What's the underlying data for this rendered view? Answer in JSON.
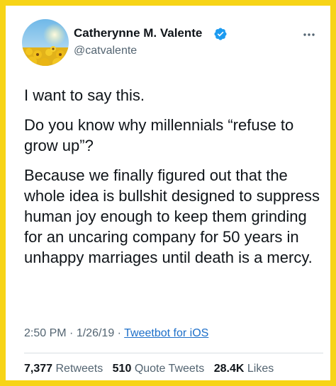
{
  "author": {
    "name": "Catherynne M. Valente",
    "handle": "@catvalente"
  },
  "icons": {
    "avatar": "sunflower-field-avatar",
    "verified": "verified-badge-icon",
    "more": "more-options-icon"
  },
  "colors": {
    "frame": "#f7d417",
    "verified": "#1d9bf0",
    "link": "#1d6fc9"
  },
  "tweet": {
    "paragraphs": [
      "I want to say this.",
      "Do you know why millennials “refuse to grow up”?",
      "Because we finally figured out that the whole idea is bullshit designed to suppress human joy enough to keep them grinding for an uncaring company for 50 years in unhappy marriages until death is a mercy."
    ]
  },
  "meta": {
    "time": "2:50 PM",
    "date": "1/26/19",
    "separator": "·",
    "source": "Tweetbot for iOS"
  },
  "stats": {
    "retweets_count": "7,377",
    "retweets_label": "Retweets",
    "quotes_count": "510",
    "quotes_label": "Quote Tweets",
    "likes_count": "28.4K",
    "likes_label": "Likes"
  }
}
